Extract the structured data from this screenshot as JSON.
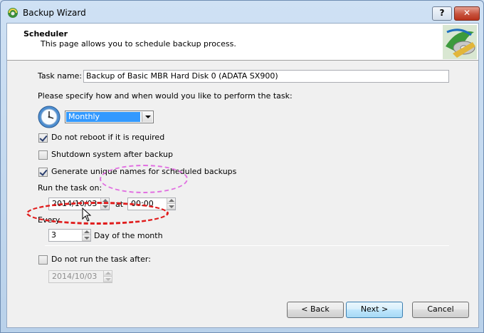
{
  "window": {
    "title": "Backup Wizard",
    "help_label": "?",
    "close_label": "✕"
  },
  "header": {
    "title": "Scheduler",
    "subtitle": "This page allows you to schedule backup process."
  },
  "task": {
    "label": "Task name:",
    "value": "Backup of Basic MBR Hard Disk 0 (ADATA SX900)"
  },
  "schedule": {
    "prompt": "Please specify how and when would you like to perform the task:",
    "frequency_value": "Monthly"
  },
  "options": [
    {
      "label": "Do not reboot if it is required",
      "checked": true
    },
    {
      "label": "Shutdown system after backup",
      "checked": false
    },
    {
      "label": "Generate unique names for scheduled backups",
      "checked": true
    }
  ],
  "run": {
    "label": "Run the task on:",
    "date": "2014/10/03",
    "at_label": "at",
    "time": "00:00"
  },
  "every": {
    "label": "Every",
    "value": "3",
    "unit": "Day of the month"
  },
  "end": {
    "label": "Do not run the task after:",
    "checked": false,
    "date": "2014/10/03"
  },
  "buttons": {
    "back": "< Back",
    "next": "Next >",
    "cancel": "Cancel"
  },
  "icons": {
    "app": "backup-wizard-icon",
    "header": "backup-disk-icon",
    "clock": "clock-icon",
    "cursor": "mouse-cursor-icon"
  },
  "colors": {
    "selection": "#3399ff",
    "annotation_pink": "#e16fe1",
    "annotation_red": "#e01d1d"
  }
}
